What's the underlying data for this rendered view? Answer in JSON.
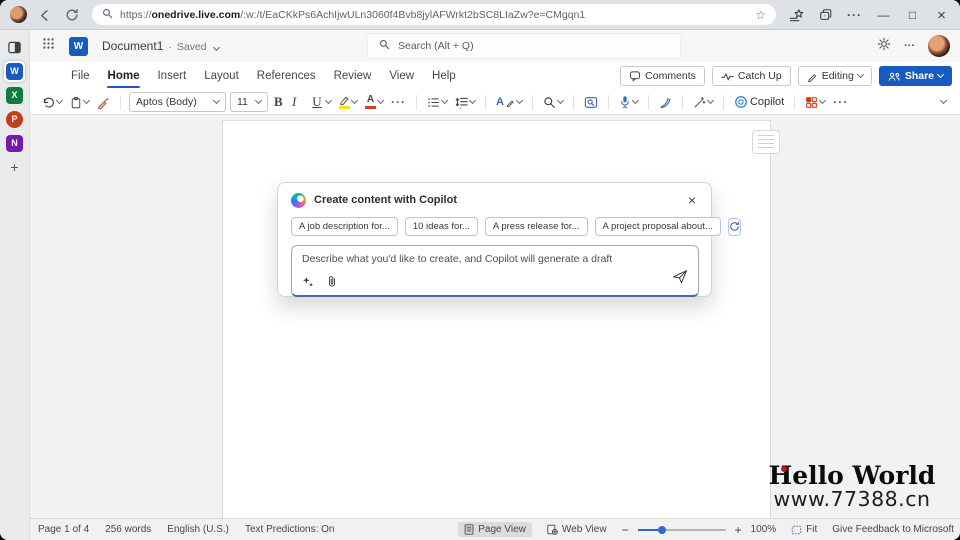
{
  "browser": {
    "url_scheme": "https://",
    "url_domain": "onedrive.live.com",
    "url_path": "/:w:/t/EaCKkPs6AchIjwULn3060f4Bvb8jylAFWrkt2bSC8LIaZw?e=CMgqn1"
  },
  "icons": {
    "ellipsis": "···",
    "minimize": "—",
    "maximize": "□",
    "close": "×",
    "star": "☆",
    "plus": "+",
    "minus": "−",
    "dot_separator": "·"
  },
  "sidebar": {
    "word": "W",
    "excel": "X",
    "powerpoint": "P",
    "onenote": "N",
    "add": "+"
  },
  "header": {
    "doc_title": "Document1",
    "save_status": "Saved",
    "search_placeholder": "Search (Alt + Q)"
  },
  "ribbon": {
    "tabs": [
      "File",
      "Home",
      "Insert",
      "Layout",
      "References",
      "Review",
      "View",
      "Help"
    ],
    "comments": "Comments",
    "catch_up": "Catch Up",
    "editing": "Editing",
    "share": "Share"
  },
  "toolbar": {
    "font_name": "Aptos (Body)",
    "font_size": "11",
    "bold": "B",
    "italic": "I",
    "underline": "U",
    "font_color_letter": "A",
    "styles_letter": "A",
    "copilot": "Copilot"
  },
  "dialog": {
    "title": "Create content with Copilot",
    "chips": [
      "A job description for...",
      "10 ideas for...",
      "A press release for...",
      "A project proposal about..."
    ],
    "input_placeholder": "Describe what you'd like to create, and Copilot will generate a draft"
  },
  "watermark": {
    "line1": "Hello World",
    "line2": "www.77388.cn"
  },
  "statusbar": {
    "page": "Page 1 of 4",
    "words": "256 words",
    "language": "English (U.S.)",
    "predictions": "Text Predictions: On",
    "page_view": "Page View",
    "web_view": "Web View",
    "zoom_level": "100%",
    "fit": "Fit",
    "feedback": "Give Feedback to Microsoft"
  },
  "colors": {
    "word_blue": "#185abd",
    "copilot_underline": "#4268b3",
    "highlight_yellow": "#f2e50b",
    "font_red": "#d83b2a",
    "apps_orange": "#d83b01"
  }
}
